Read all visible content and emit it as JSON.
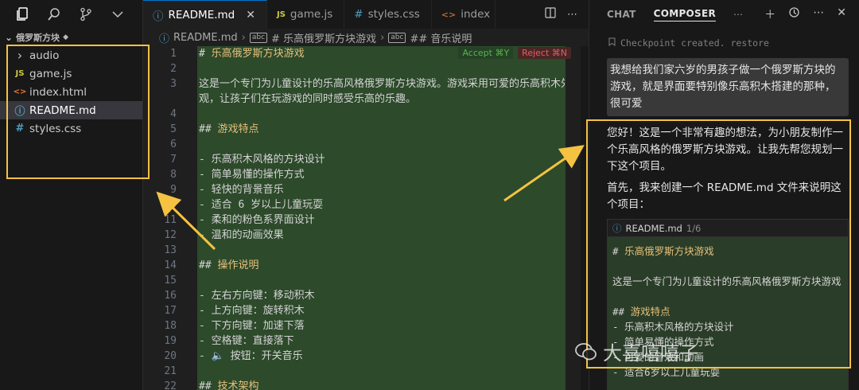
{
  "explorer": {
    "folder": "俄罗斯方块",
    "items": [
      {
        "label": "audio",
        "icon": "chevron-right-icon",
        "type": "folder"
      },
      {
        "label": "game.js",
        "icon": "js-file-icon",
        "type": "js"
      },
      {
        "label": "index.html",
        "icon": "html-file-icon",
        "type": "html"
      },
      {
        "label": "README.md",
        "icon": "info-file-icon",
        "type": "md"
      },
      {
        "label": "styles.css",
        "icon": "css-file-icon",
        "type": "css"
      }
    ]
  },
  "tabs": [
    {
      "label": "README.md",
      "icon_text": "ⓘ"
    },
    {
      "label": "game.js",
      "icon_text": "JS"
    },
    {
      "label": "styles.css",
      "icon_text": "#"
    },
    {
      "label": "index",
      "icon_text": "<>"
    }
  ],
  "breadcrumb": {
    "file": "README.md",
    "h1": "# 乐高俄罗斯方块游戏",
    "h2": "## 音乐说明",
    "sym": "abc"
  },
  "diff_actions": {
    "accept": "Accept ⌘Y",
    "reject": "Reject ⌘N"
  },
  "editor": {
    "line_numbers": [
      "1",
      "2",
      "3",
      "",
      "4",
      "5",
      "6",
      "7",
      "8",
      "9",
      "10",
      "11",
      "12",
      "13",
      "14",
      "15",
      "16",
      "17",
      "18",
      "19",
      "20",
      "21",
      "22"
    ],
    "lines": [
      {
        "hash": "# ",
        "text": "乐高俄罗斯方块游戏",
        "heading": true
      },
      {
        "text": ""
      },
      {
        "text": "这是一个专门为儿童设计的乐高风格俄罗斯方块游戏。游戏采用可爱的乐高积木外"
      },
      {
        "text": "观，让孩子们在玩游戏的同时感受乐高的乐趣。"
      },
      {
        "text": ""
      },
      {
        "hash": "## ",
        "text": "游戏特点",
        "heading": true
      },
      {
        "text": ""
      },
      {
        "text": "- 乐高积木风格的方块设计"
      },
      {
        "text": "- 简单易懂的操作方式"
      },
      {
        "text": "- 轻快的背景音乐"
      },
      {
        "text": "- 适合 6 岁以上儿童玩耍"
      },
      {
        "text": "- 柔和的粉色系界面设计"
      },
      {
        "text": "- 温和的动画效果"
      },
      {
        "text": ""
      },
      {
        "hash": "## ",
        "text": "操作说明",
        "heading": true
      },
      {
        "text": ""
      },
      {
        "text": "- 左右方向键：移动积木"
      },
      {
        "text": "- 上方向键：旋转积木"
      },
      {
        "text": "- 下方向键：加速下落"
      },
      {
        "text": "- 空格键：直接落下"
      },
      {
        "text": "- 🔈 按钮：开关音乐"
      },
      {
        "text": ""
      },
      {
        "hash": "## ",
        "text": "技术架构",
        "heading": true
      }
    ]
  },
  "composer": {
    "tabs": [
      "CHAT",
      "COMPOSER"
    ],
    "checkpoint": "Checkpoint created. restore",
    "user_message": "我想给我们家六岁的男孩子做一个俄罗斯方块的游戏，就是界面要特别像乐高积木搭建的那种，很可爱",
    "assistant_p1": "您好！这是一个非常有趣的想法，为小朋友制作一个乐高风格的俄罗斯方块游戏。让我先帮您规划一下这个项目。",
    "assistant_p2": "首先，我来创建一个 README.md 文件来说明这个项目：",
    "card_file": "README.md",
    "card_count": "1/6",
    "card_lines": [
      {
        "hash": "# ",
        "text": "乐高俄罗斯方块游戏",
        "heading": true
      },
      {
        "text": ""
      },
      {
        "text": "这是一个专门为儿童设计的乐高风格俄罗斯方块游戏"
      },
      {
        "text": ""
      },
      {
        "hash": "## ",
        "text": "游戏特点",
        "heading": true
      },
      {
        "text": "- 乐高积木风格的方块设计"
      },
      {
        "text": "- 简单易懂的操作方式"
      },
      {
        "text": "- 可爱的音效和动画"
      },
      {
        "text": "- 适合6岁以上儿童玩耍"
      }
    ]
  },
  "watermark": "大喜嘻嘻子",
  "colors": {
    "highlight": "#f5c242",
    "heading": "#e5c07b",
    "diff_bg": "#2d4a2b",
    "accent": "#0078d4"
  }
}
